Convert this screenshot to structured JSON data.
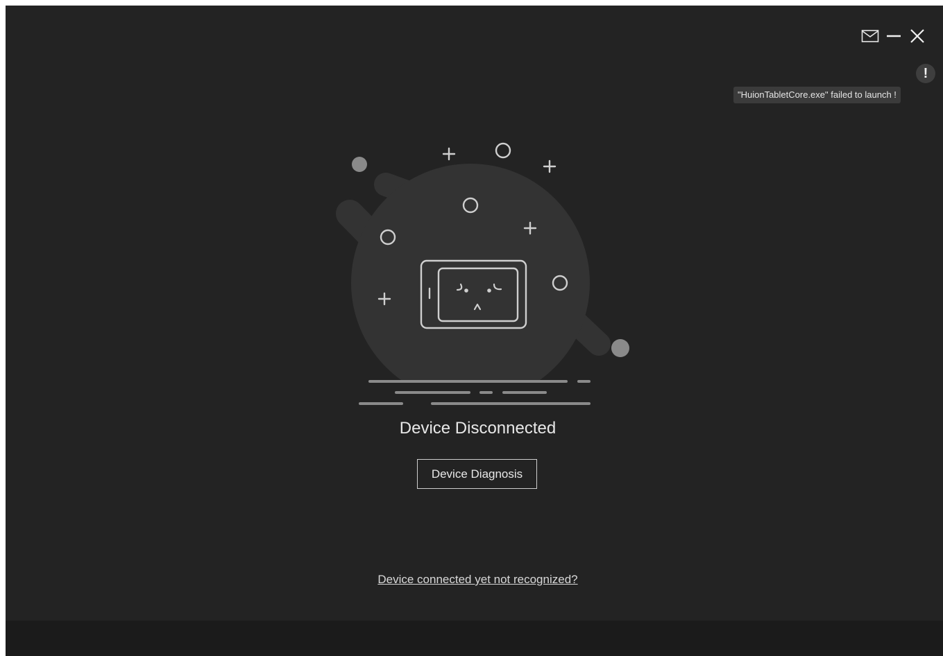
{
  "window": {
    "controls": {
      "mail_icon": "mail-icon",
      "minimize_icon": "minimize-icon",
      "close_icon": "close-icon"
    }
  },
  "notification": {
    "icon": "warning-icon",
    "message": "\"HuionTabletCore.exe\" failed to launch !"
  },
  "main": {
    "illustration_icon": "disconnected-tablet-icon",
    "status_title": "Device Disconnected",
    "diagnosis_button_label": "Device Diagnosis",
    "help_link_text": "Device connected yet not recognized?"
  },
  "colors": {
    "background": "#232323",
    "footer": "#1b1b1b",
    "blob": "#333333",
    "accent_gray": "#8a8a8a",
    "text": "#e8e8e8"
  }
}
